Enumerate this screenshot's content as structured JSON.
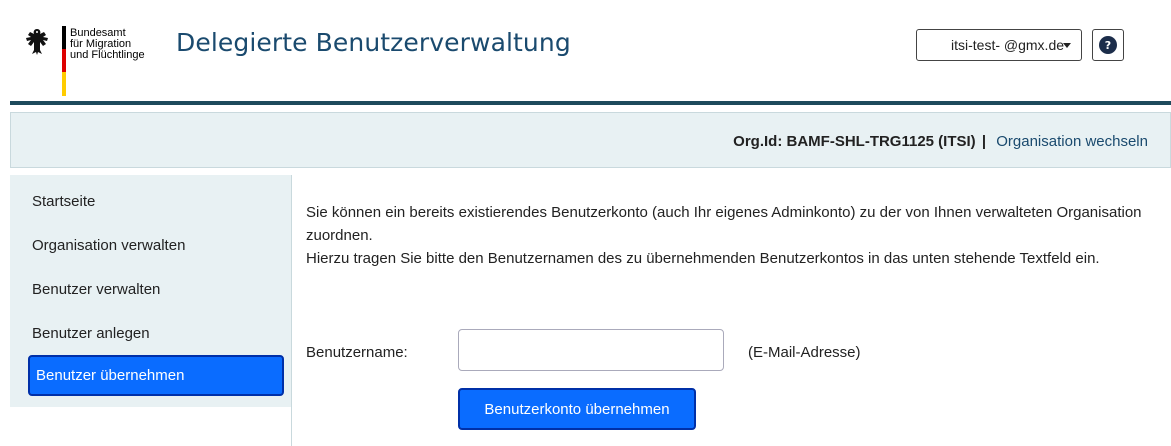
{
  "header": {
    "logo_lines": [
      "Bundesamt",
      "für Migration",
      "und Flüchtlinge"
    ],
    "app_title": "Delegierte Benutzerverwaltung",
    "user_menu": {
      "label": "itsi-test- @gmx.de"
    },
    "help_icon": "help-icon"
  },
  "org_bar": {
    "org_id": "Org.Id: BAMF-SHL-TRG1125 (ITSI)",
    "separator": "|",
    "switch_link": "Organisation wechseln"
  },
  "sidebar": {
    "items": [
      {
        "label": "Startseite",
        "active": false
      },
      {
        "label": "Organisation verwalten",
        "active": false
      },
      {
        "label": "Benutzer verwalten",
        "active": false
      },
      {
        "label": "Benutzer anlegen",
        "active": false
      },
      {
        "label": "Benutzer übernehmen",
        "active": true
      }
    ]
  },
  "main": {
    "paragraph1": "Sie können ein bereits existierendes Benutzerkonto (auch Ihr eigenes Adminkonto) zu der von Ihnen verwalteten Organisation zuordnen.",
    "paragraph2": "Hierzu tragen Sie bitte den Benutzernamen des zu übernehmenden Benutzerkontos in das unten stehende Textfeld ein.",
    "field_label": "Benutzername:",
    "field_value": "",
    "field_hint": "(E-Mail-Adresse)",
    "submit_label": "Benutzerkonto übernehmen"
  },
  "colors": {
    "title": "#1a4a6e",
    "accent": "#0a6cff",
    "panel": "#e8f1f3",
    "divider": "#1d4a5c"
  }
}
